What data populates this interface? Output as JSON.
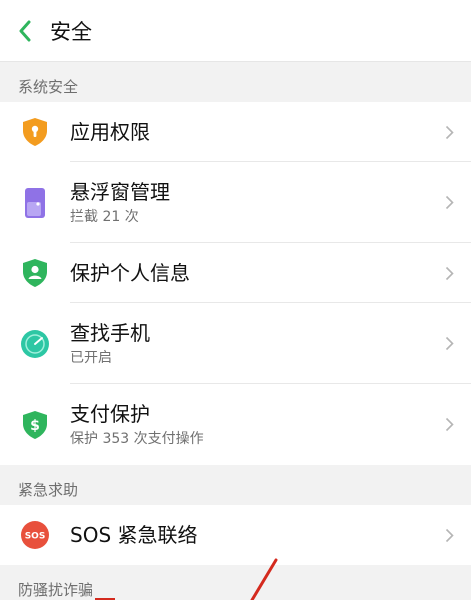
{
  "header": {
    "title": "安全"
  },
  "sections": [
    {
      "label": "系统安全",
      "items": [
        {
          "title": "应用权限",
          "subtitle": "",
          "icon": "shield-lock-icon"
        },
        {
          "title": "悬浮窗管理",
          "subtitle": "拦截 21 次",
          "icon": "floating-window-icon"
        },
        {
          "title": "保护个人信息",
          "subtitle": "",
          "icon": "shield-person-icon"
        },
        {
          "title": "查找手机",
          "subtitle": "已开启",
          "icon": "find-phone-icon"
        },
        {
          "title": "支付保护",
          "subtitle": "保护 353 次支付操作",
          "icon": "shield-dollar-icon"
        }
      ]
    },
    {
      "label": "紧急求助",
      "items": [
        {
          "title": "SOS 紧急联络",
          "subtitle": "",
          "icon": "sos-icon",
          "icon_text": "SOS"
        }
      ]
    },
    {
      "label": "防骚扰诈骗"
    }
  ],
  "colors": {
    "accent_green": "#2fb55d",
    "orange": "#f39c1f",
    "purple": "#8f72e6",
    "teal": "#2dc7a4",
    "red_sos": "#e8503c",
    "annotation_red": "#d42a1e"
  }
}
